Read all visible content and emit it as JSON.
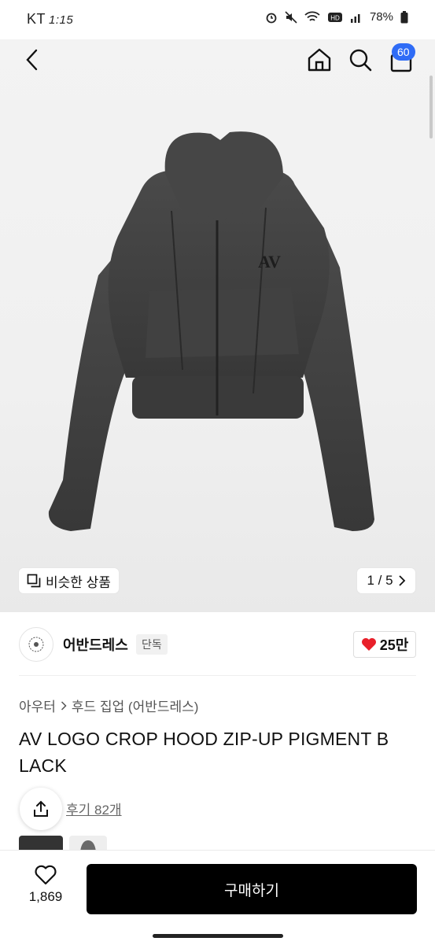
{
  "status_bar": {
    "carrier": "KT",
    "time": "1:15",
    "battery": "78%"
  },
  "nav": {
    "cart_count": "60"
  },
  "gallery": {
    "similar_label": "비슷한 상품",
    "page_indicator": "1 / 5"
  },
  "brand": {
    "name": "어반드레스",
    "tag": "단독",
    "likes": "25만"
  },
  "breadcrumb": {
    "category": "아우터",
    "subcategory": "후드 집업 (어반드레스)"
  },
  "product": {
    "title": "AV LOGO CROP HOOD ZIP-UP PIGMENT B LACK",
    "reviews": "후기 82개"
  },
  "bottom_bar": {
    "wish_count": "1,869",
    "buy_label": "구매하기"
  },
  "colors": {
    "accent_blue": "#2f6cf6",
    "heart_red": "#e8202a",
    "buy_button": "#000000",
    "garment": "#3f3f3f"
  }
}
